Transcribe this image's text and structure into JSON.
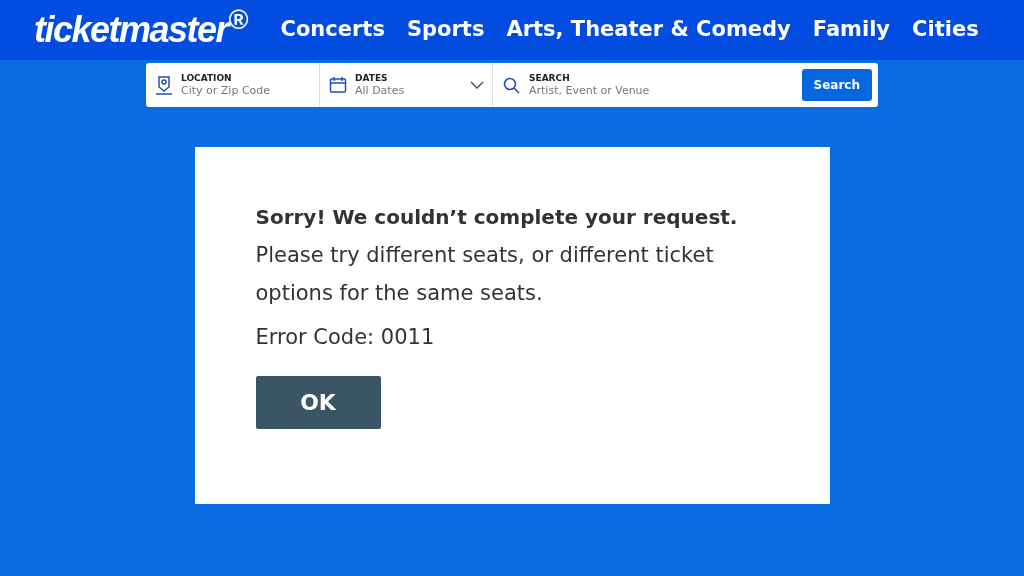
{
  "header": {
    "logo": "ticketmaster$^{®}$",
    "nav": [
      "Concerts",
      "Sports",
      "Arts, Theater & Comedy",
      "Family",
      "Cities"
    ]
  },
  "search_bar": {
    "location": {
      "label": "LOCATION",
      "placeholder": "City or Zip Code"
    },
    "dates": {
      "label": "DATES",
      "value": "All Dates"
    },
    "search": {
      "label": "SEARCH",
      "placeholder": "Artist, Event or Venue"
    },
    "button": "Search"
  },
  "dialog": {
    "title": "Sorry! We couldn’t complete your request.",
    "message": "Please try different seats, or different ticket options for the same seats.",
    "error_code": "Error Code: 0011",
    "button": "OK"
  }
}
